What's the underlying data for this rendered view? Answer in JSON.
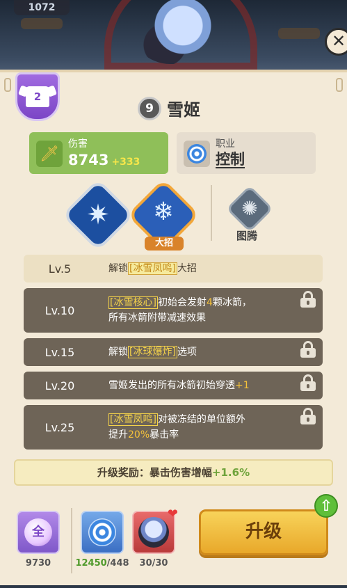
{
  "top": {
    "coin_count": "1072",
    "close_label": "✕"
  },
  "tier_badge": {
    "value": "2"
  },
  "hero": {
    "star": "9",
    "name": "雪姬"
  },
  "stats": {
    "damage": {
      "label": "伤害",
      "value": "8743",
      "bonus": "+333"
    },
    "class": {
      "label": "职业",
      "value": "控制"
    }
  },
  "skills": {
    "ult_tag": "大招",
    "totem_label": "图腾"
  },
  "levels": [
    {
      "lv": "Lv.5",
      "locked": false,
      "pre": "解锁",
      "hl": "[冰雪凤鸣]",
      "post": "大招"
    },
    {
      "lv": "Lv.10",
      "locked": true,
      "hl": "[冰雪核心]",
      "post": "初始会发射",
      "num": "4",
      "post2": "颗冰箭，",
      "line2": "所有冰箭附带减速效果"
    },
    {
      "lv": "Lv.15",
      "locked": true,
      "pre": "解锁",
      "hl": "[冰球爆炸]",
      "post": "选项"
    },
    {
      "lv": "Lv.20",
      "locked": true,
      "pre": "雪姬发出的所有冰箭初始穿透",
      "num": "+1"
    },
    {
      "lv": "Lv.25",
      "locked": true,
      "hl": "[冰雪凤鸣]",
      "post": "对被冻结的单位额外",
      "line2pre": "提升",
      "num": "20%",
      "line2post": "暴击率"
    }
  ],
  "reward": {
    "label": "升级奖励：暴击伤害增幅",
    "value": "+1.6%"
  },
  "costs": {
    "all_label": "全",
    "all_count": "9730",
    "class_have": "12450",
    "class_need": "/448",
    "shard_count": "30/30"
  },
  "upgrade_button": "升级",
  "colors": {
    "accent": "#e8a82a",
    "panel": "#f3ead8",
    "locked_row": "#6e6457",
    "green": "#8fbf59"
  }
}
